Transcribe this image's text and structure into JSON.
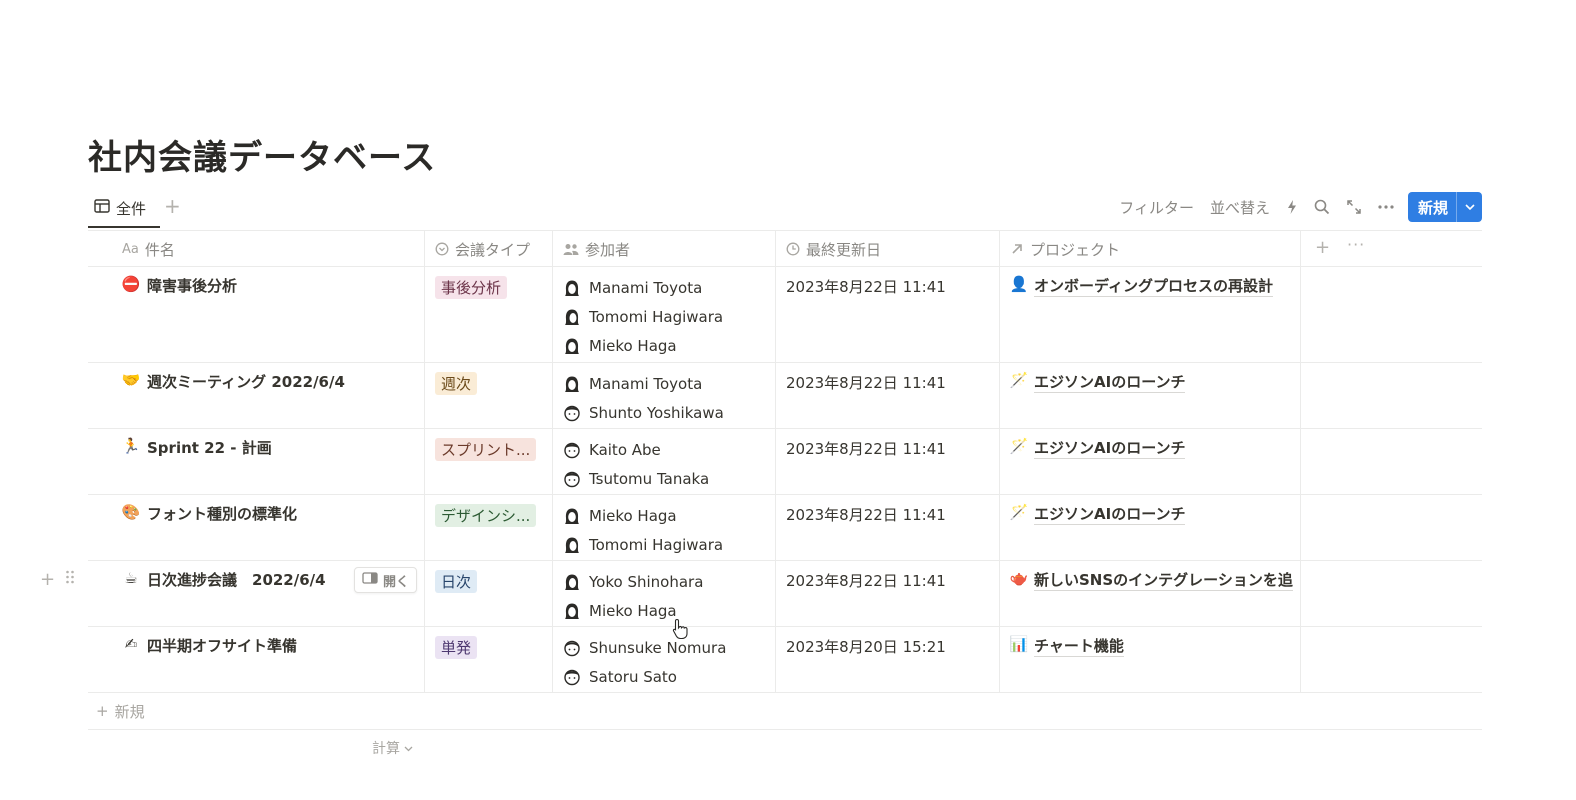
{
  "page": {
    "title": "社内会議データベース"
  },
  "view": {
    "tab_label": "全件",
    "add_view": "+"
  },
  "toolbar": {
    "filter": "フィルター",
    "sort": "並べ替え",
    "new_label": "新規",
    "automation_icon": "lightning-icon",
    "search_icon": "search-icon",
    "expand_icon": "expand-icon",
    "more_icon": "more-icon",
    "accent": "#2f7ee3"
  },
  "columns": {
    "name": {
      "prefix": "Aa",
      "label": "件名"
    },
    "type": {
      "label": "会議タイプ"
    },
    "attendees": {
      "label": "参加者"
    },
    "updated": {
      "label": "最終更新日"
    },
    "project": {
      "label": "プロジェクト"
    },
    "add": "+",
    "more": "···"
  },
  "rows": [
    {
      "icon": "⛔",
      "title": "障害事後分析",
      "type": "事後分析",
      "type_bg": "#f6e3ea",
      "type_fg": "#6b3348",
      "people": [
        "Manami Toyota",
        "Tomomi Hagiwara",
        "Mieko Haga"
      ],
      "updated": "2023年8月22日 11:41",
      "project_icon": "👤",
      "project": "オンボーディングプロセスの再設計"
    },
    {
      "icon": "🤝",
      "title": "週次ミーティング 2022/6/4",
      "type": "週次",
      "type_bg": "#faecd6",
      "type_fg": "#6b4a1a",
      "people": [
        "Manami Toyota",
        "Shunto Yoshikawa"
      ],
      "updated": "2023年8月22日 11:41",
      "project_icon": "🪄",
      "project": "エジソンAIのローンチ"
    },
    {
      "icon": "🏃",
      "title": "Sprint 22 - 計画",
      "type": "スプリント...",
      "type_bg": "#f7e3dd",
      "type_fg": "#6b3a2a",
      "people": [
        "Kaito Abe",
        "Tsutomu Tanaka"
      ],
      "updated": "2023年8月22日 11:41",
      "project_icon": "🪄",
      "project": "エジソンAIのローンチ"
    },
    {
      "icon": "🎨",
      "title": "フォント種別の標準化",
      "type": "デザインシ...",
      "type_bg": "#e2efe3",
      "type_fg": "#2c5a33",
      "people": [
        "Mieko Haga",
        "Tomomi Hagiwara"
      ],
      "updated": "2023年8月22日 11:41",
      "project_icon": "🪄",
      "project": "エジソンAIのローンチ"
    },
    {
      "icon": "☕",
      "title": "日次進捗会議　2022/6/4",
      "type": "日次",
      "type_bg": "#dfebf5",
      "type_fg": "#28456b",
      "people": [
        "Yoko Shinohara",
        "Mieko Haga"
      ],
      "updated": "2023年8月22日 11:41",
      "project_icon": "🫖",
      "project": "新しいSNSのインテグレーションを追",
      "open_label": "開く"
    },
    {
      "icon": "✍",
      "title": "四半期オフサイト準備",
      "type": "単発",
      "type_bg": "#ebe3f3",
      "type_fg": "#4e3870",
      "people": [
        "Shunsuke Nomura",
        "Satoru Sato"
      ],
      "updated": "2023年8月20日 15:21",
      "project_icon": "📊",
      "project": "チャート機能"
    }
  ],
  "footer": {
    "new_label": "新規",
    "calc_label": "計算"
  }
}
